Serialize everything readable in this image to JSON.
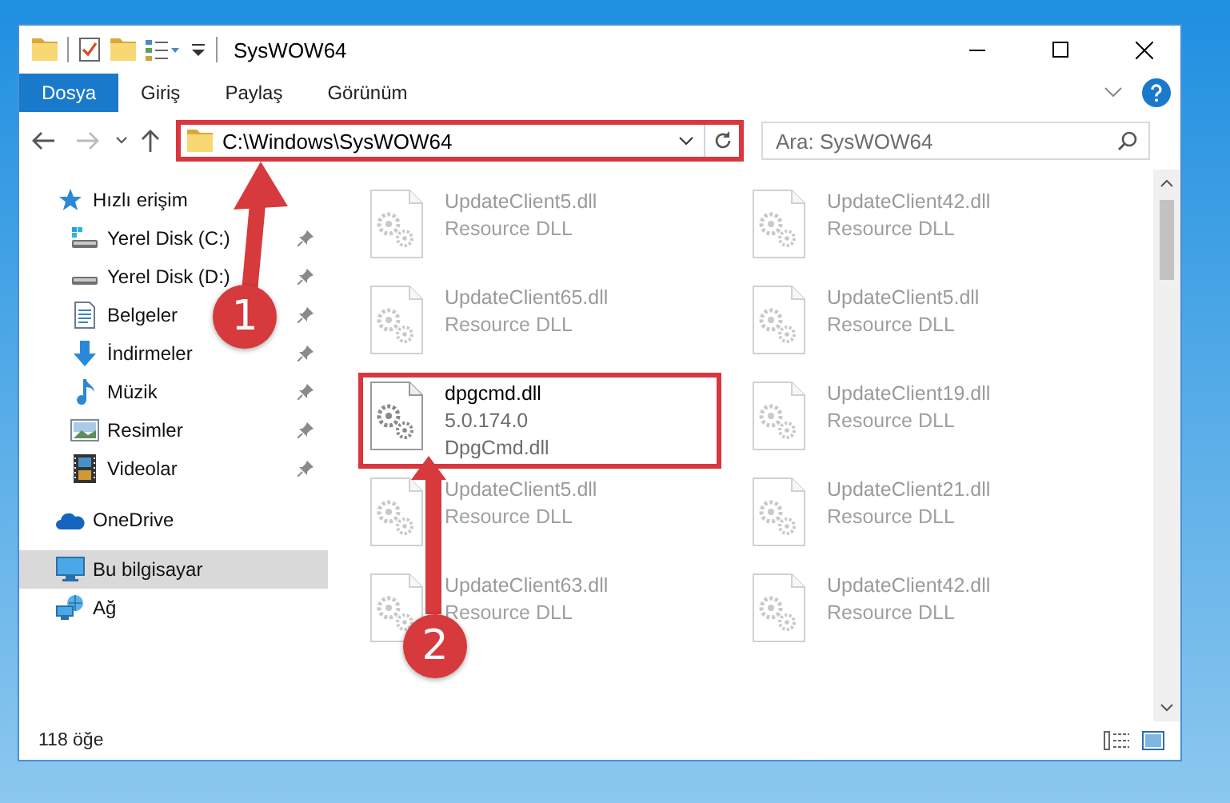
{
  "window": {
    "title": "SysWOW64"
  },
  "ribbon_tabs": [
    {
      "label": "Dosya",
      "selected": true
    },
    {
      "label": "Giriş",
      "selected": false
    },
    {
      "label": "Paylaş",
      "selected": false
    },
    {
      "label": "Görünüm",
      "selected": false
    }
  ],
  "address": {
    "path": "C:\\Windows\\SysWOW64",
    "highlighted": true
  },
  "search": {
    "placeholder": "Ara: SysWOW64"
  },
  "sidebar": {
    "items": [
      {
        "label": "Hızlı erişim",
        "selected": false,
        "children": [
          {
            "label": "Yerel Disk (C:)",
            "selected": false,
            "pinned": true
          },
          {
            "label": "Yerel Disk (D:)",
            "selected": false,
            "pinned": true
          },
          {
            "label": "Belgeler",
            "selected": false,
            "pinned": true
          },
          {
            "label": "İndirmeler",
            "selected": false,
            "pinned": true
          },
          {
            "label": "Müzik",
            "selected": false,
            "pinned": true
          },
          {
            "label": "Resimler",
            "selected": false,
            "pinned": true
          },
          {
            "label": "Videolar",
            "selected": false,
            "pinned": true
          }
        ]
      },
      {
        "label": "OneDrive",
        "selected": false
      },
      {
        "label": "Bu bilgisayar",
        "selected": true
      },
      {
        "label": "Ağ",
        "selected": false
      }
    ]
  },
  "files": [
    {
      "name": "UpdateClient5.dll",
      "details": [
        "Resource DLL"
      ],
      "dimmed": true,
      "highlighted": false
    },
    {
      "name": "UpdateClient42.dll",
      "details": [
        "Resource DLL"
      ],
      "dimmed": true,
      "highlighted": false
    },
    {
      "name": "UpdateClient65.dll",
      "details": [
        "Resource DLL"
      ],
      "dimmed": true,
      "highlighted": false
    },
    {
      "name": "UpdateClient5.dll",
      "details": [
        "Resource DLL"
      ],
      "dimmed": true,
      "highlighted": false
    },
    {
      "name": "dpgcmd.dll",
      "details": [
        "5.0.174.0",
        "DpgCmd.dll"
      ],
      "dimmed": false,
      "highlighted": true
    },
    {
      "name": "UpdateClient19.dll",
      "details": [
        "Resource DLL"
      ],
      "dimmed": true,
      "highlighted": false
    },
    {
      "name": "UpdateClient5.dll",
      "details": [
        "Resource DLL"
      ],
      "dimmed": true,
      "highlighted": false
    },
    {
      "name": "UpdateClient21.dll",
      "details": [
        "Resource DLL"
      ],
      "dimmed": true,
      "highlighted": false
    },
    {
      "name": "UpdateClient63.dll",
      "details": [
        "Resource DLL"
      ],
      "dimmed": true,
      "highlighted": false
    },
    {
      "name": "UpdateClient42.dll",
      "details": [
        "Resource DLL"
      ],
      "dimmed": true,
      "highlighted": false
    }
  ],
  "status_bar": {
    "item_count": "118 öğe"
  },
  "annotations": [
    {
      "number": "1"
    },
    {
      "number": "2"
    }
  ]
}
